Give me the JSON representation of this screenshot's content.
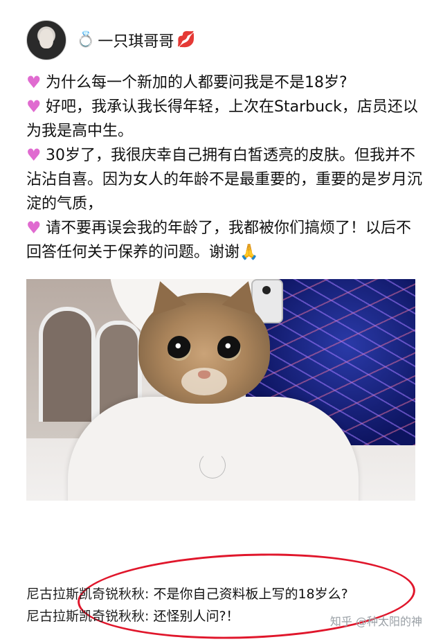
{
  "post": {
    "author": "一只琪哥哥",
    "author_prefix_icon": "ring-icon",
    "author_suffix_icon": "kiss-icon",
    "paragraphs": [
      {
        "icon": "heart-icon",
        "text": "为什么每一个新加的人都要问我是不是18岁?"
      },
      {
        "icon": "heart-icon",
        "text": "好吧，我承认我长得年轻，上次在Starbuck，店员还以为我是高中生。"
      },
      {
        "icon": "heart-icon",
        "text": "30岁了，我很庆幸自己拥有白皙透亮的皮肤。但我并不沾沾自喜。因为女人的年龄不是最重要的，重要的是岁月沉淀的气质，"
      },
      {
        "icon": "heart-icon",
        "text": "请不要再误会我的年龄了，我都被你们搞烦了！以后不回答任何关于保养的问题。谢谢"
      }
    ],
    "end_icon": "pray-icon"
  },
  "comments": [
    {
      "author": "尼古拉斯凯奇锐秋秋:",
      "text": "不是你自己资料板上写的18岁么?"
    },
    {
      "author": "尼古拉斯凯奇锐秋秋:",
      "text": "还怪别人问?！"
    }
  ],
  "watermark": "知乎 @种太阳的神",
  "colors": {
    "highlight_circle": "#e0162b",
    "heart": "#e06bd0"
  }
}
